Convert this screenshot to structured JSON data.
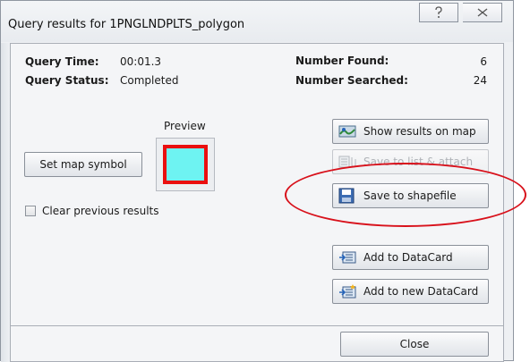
{
  "window": {
    "title": "Query results for 1PNGLNDPLTS_polygon",
    "help_glyph": "?",
    "close_glyph": "X"
  },
  "info": {
    "query_time_label": "Query Time:",
    "query_time_value": "00:01.3",
    "query_status_label": "Query Status:",
    "query_status_value": "Completed",
    "number_found_label": "Number Found:",
    "number_found_value": "6",
    "number_searched_label": "Number Searched:",
    "number_searched_value": "24"
  },
  "symbol": {
    "preview_label": "Preview",
    "set_button": "Set map symbol",
    "fill_color": "#6ef3f2",
    "border_color": "#ea0f0f",
    "clear_label": "Clear previous results",
    "clear_checked": false
  },
  "actions": {
    "show_results": "Show results on map",
    "save_to_list": "Save to list & attach",
    "save_shapefile": "Save to shapefile",
    "add_datacard": "Add to DataCard",
    "add_new_datacard": "Add to new DataCard"
  },
  "footer": {
    "close_label": "Close"
  },
  "annotation": {
    "color": "#d8111b"
  }
}
